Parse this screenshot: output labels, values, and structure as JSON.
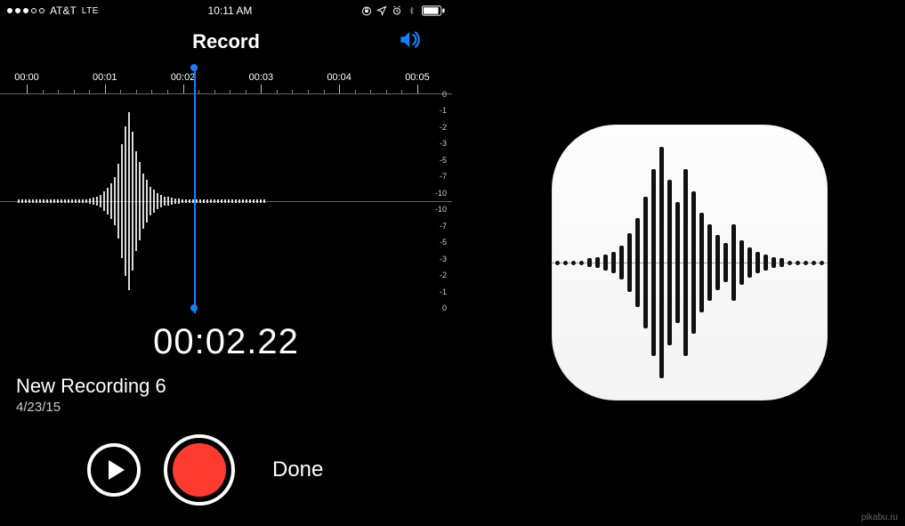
{
  "status_bar": {
    "signal_filled": 3,
    "signal_total": 5,
    "carrier": "AT&T",
    "network_type": "LTE",
    "time": "10:11 AM"
  },
  "header": {
    "title": "Record"
  },
  "ruler": {
    "labels": [
      "00:00",
      "00:01",
      "00:02",
      "00:03",
      "00:04",
      "00:05"
    ]
  },
  "db_scale": [
    "0",
    "-1",
    "-2",
    "-3",
    "-5",
    "-7",
    "-10",
    "-10",
    "-7",
    "-5",
    "-3",
    "-2",
    "-1",
    "0"
  ],
  "waveform_bars": [
    2,
    2,
    2,
    2,
    2,
    2,
    2,
    2,
    2,
    2,
    2,
    2,
    2,
    2,
    2,
    2,
    2,
    2,
    2,
    2,
    3,
    4,
    6,
    8,
    12,
    16,
    22,
    30,
    46,
    70,
    92,
    110,
    86,
    62,
    48,
    34,
    26,
    18,
    14,
    10,
    8,
    6,
    5,
    4,
    3,
    3,
    2,
    2,
    2,
    2,
    2,
    2,
    2,
    2,
    2,
    2,
    2,
    2,
    2,
    2,
    2,
    2,
    2,
    2,
    2,
    2,
    2,
    2,
    2,
    2
  ],
  "playhead_position_pct": 43,
  "timer": "00:02.22",
  "recording": {
    "title": "New Recording 6",
    "date": "4/23/15"
  },
  "controls": {
    "done_label": "Done"
  },
  "footer_credit": "pikabu.ru",
  "icon_waveform_bars": [
    4,
    4,
    4,
    4,
    4,
    4,
    4,
    5,
    6,
    8,
    10,
    14,
    20,
    30,
    54,
    80,
    120,
    170,
    210,
    150,
    110,
    170,
    130,
    90,
    70,
    50,
    36,
    70,
    40,
    28,
    20,
    14,
    10,
    8,
    6,
    5,
    4,
    4,
    4,
    4,
    4,
    4,
    4,
    4
  ]
}
